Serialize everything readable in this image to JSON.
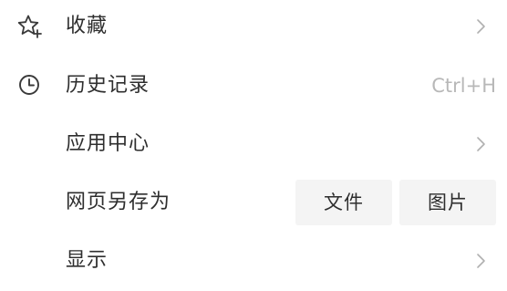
{
  "menu": {
    "items": [
      {
        "label": "收藏",
        "icon": "star-plus-icon",
        "submenu": true
      },
      {
        "label": "历史记录",
        "icon": "clock-icon",
        "shortcut": "Ctrl+H"
      },
      {
        "label": "应用中心",
        "submenu": true
      },
      {
        "label": "网页另存为",
        "buttons": [
          "文件",
          "图片"
        ]
      },
      {
        "label": "显示",
        "submenu": true
      }
    ]
  },
  "colors": {
    "text": "#2e2e2e",
    "muted": "#b8b8b8",
    "button_bg": "#f4f4f4",
    "background": "#ffffff"
  }
}
